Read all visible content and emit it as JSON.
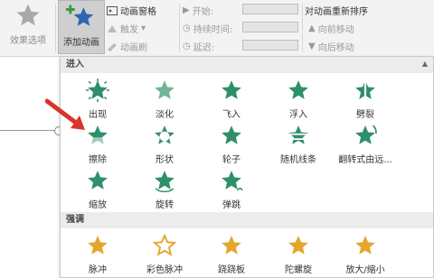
{
  "colors": {
    "star_green": "#2f8f6a",
    "star_gold": "#e3a72d",
    "arrow_red": "#d9342b"
  },
  "ribbon": {
    "effect_options_label": "效果选项",
    "add_animation_label": "添加动画",
    "animation_pane_label": "动画窗格",
    "trigger_label": "触发",
    "animation_painter_label": "动画刷",
    "start_label": "开始:",
    "duration_label": "持续时间:",
    "delay_label": "延迟:",
    "reorder_title": "对动画重新排序",
    "move_earlier_label": "向前移动",
    "move_later_label": "向后移动"
  },
  "dropdown": {
    "entrance_header": "进入",
    "emphasis_header": "强调",
    "entrance_items": [
      {
        "label": "出现",
        "icon": "star-burst-icon"
      },
      {
        "label": "淡化",
        "icon": "star-fade-icon"
      },
      {
        "label": "飞入",
        "icon": "star-fly-in-icon"
      },
      {
        "label": "浮入",
        "icon": "star-float-in-icon"
      },
      {
        "label": "劈裂",
        "icon": "star-split-icon"
      },
      {
        "label": "擦除",
        "icon": "star-wipe-icon"
      },
      {
        "label": "形状",
        "icon": "star-shape-icon"
      },
      {
        "label": "轮子",
        "icon": "star-wheel-icon"
      },
      {
        "label": "随机线条",
        "icon": "star-random-bars-icon"
      },
      {
        "label": "翻转式由远...",
        "icon": "star-grow-turn-icon"
      },
      {
        "label": "缩放",
        "icon": "star-zoom-icon"
      },
      {
        "label": "旋转",
        "icon": "star-swivel-icon"
      },
      {
        "label": "弹跳",
        "icon": "star-bounce-icon"
      }
    ],
    "emphasis_items": [
      {
        "label": "脉冲",
        "icon": "star-pulse-icon"
      },
      {
        "label": "彩色脉冲",
        "icon": "star-color-pulse-icon"
      },
      {
        "label": "跷跷板",
        "icon": "star-teeter-icon"
      },
      {
        "label": "陀螺旋",
        "icon": "star-spin-icon"
      },
      {
        "label": "放大/缩小",
        "icon": "star-grow-shrink-icon"
      }
    ]
  }
}
